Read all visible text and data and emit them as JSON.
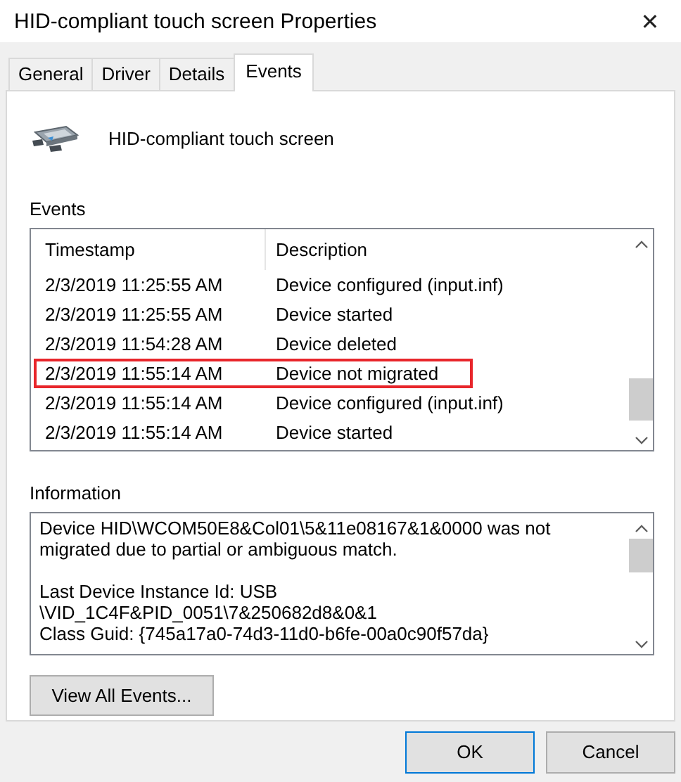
{
  "window": {
    "title": "HID-compliant touch screen Properties",
    "close": "✕"
  },
  "tabs": [
    {
      "label": "General",
      "selected": false
    },
    {
      "label": "Driver",
      "selected": false
    },
    {
      "label": "Details",
      "selected": false
    },
    {
      "label": "Events",
      "selected": true
    }
  ],
  "device": {
    "name": "HID-compliant touch screen"
  },
  "events": {
    "label": "Events",
    "columns": [
      "Timestamp",
      "Description"
    ],
    "rows": [
      {
        "timestamp": "2/3/2019 11:25:55 AM",
        "description": "Device configured (input.inf)",
        "highlighted": false
      },
      {
        "timestamp": "2/3/2019 11:25:55 AM",
        "description": "Device started",
        "highlighted": false
      },
      {
        "timestamp": "2/3/2019 11:54:28 AM",
        "description": "Device deleted",
        "highlighted": false
      },
      {
        "timestamp": "2/3/2019 11:55:14 AM",
        "description": "Device not migrated",
        "highlighted": true
      },
      {
        "timestamp": "2/3/2019 11:55:14 AM",
        "description": "Device configured (input.inf)",
        "highlighted": false
      },
      {
        "timestamp": "2/3/2019 11:55:14 AM",
        "description": "Device started",
        "highlighted": false
      }
    ]
  },
  "information": {
    "label": "Information",
    "paragraphs": [
      {
        "lines": [
          "Device HID\\WCOM50E8&Col01\\5&11e08167&1&0000 was not",
          "migrated due to partial or ambiguous match."
        ]
      },
      {
        "lines": [
          "Last Device Instance Id: USB",
          "\\VID_1C4F&PID_0051\\7&250682d8&0&1",
          "Class Guid: {745a17a0-74d3-11d0-b6fe-00a0c90f57da}"
        ]
      }
    ]
  },
  "view_all_button": "View All Events...",
  "buttons": [
    {
      "label": "OK",
      "default": true
    },
    {
      "label": "Cancel",
      "default": false
    }
  ]
}
